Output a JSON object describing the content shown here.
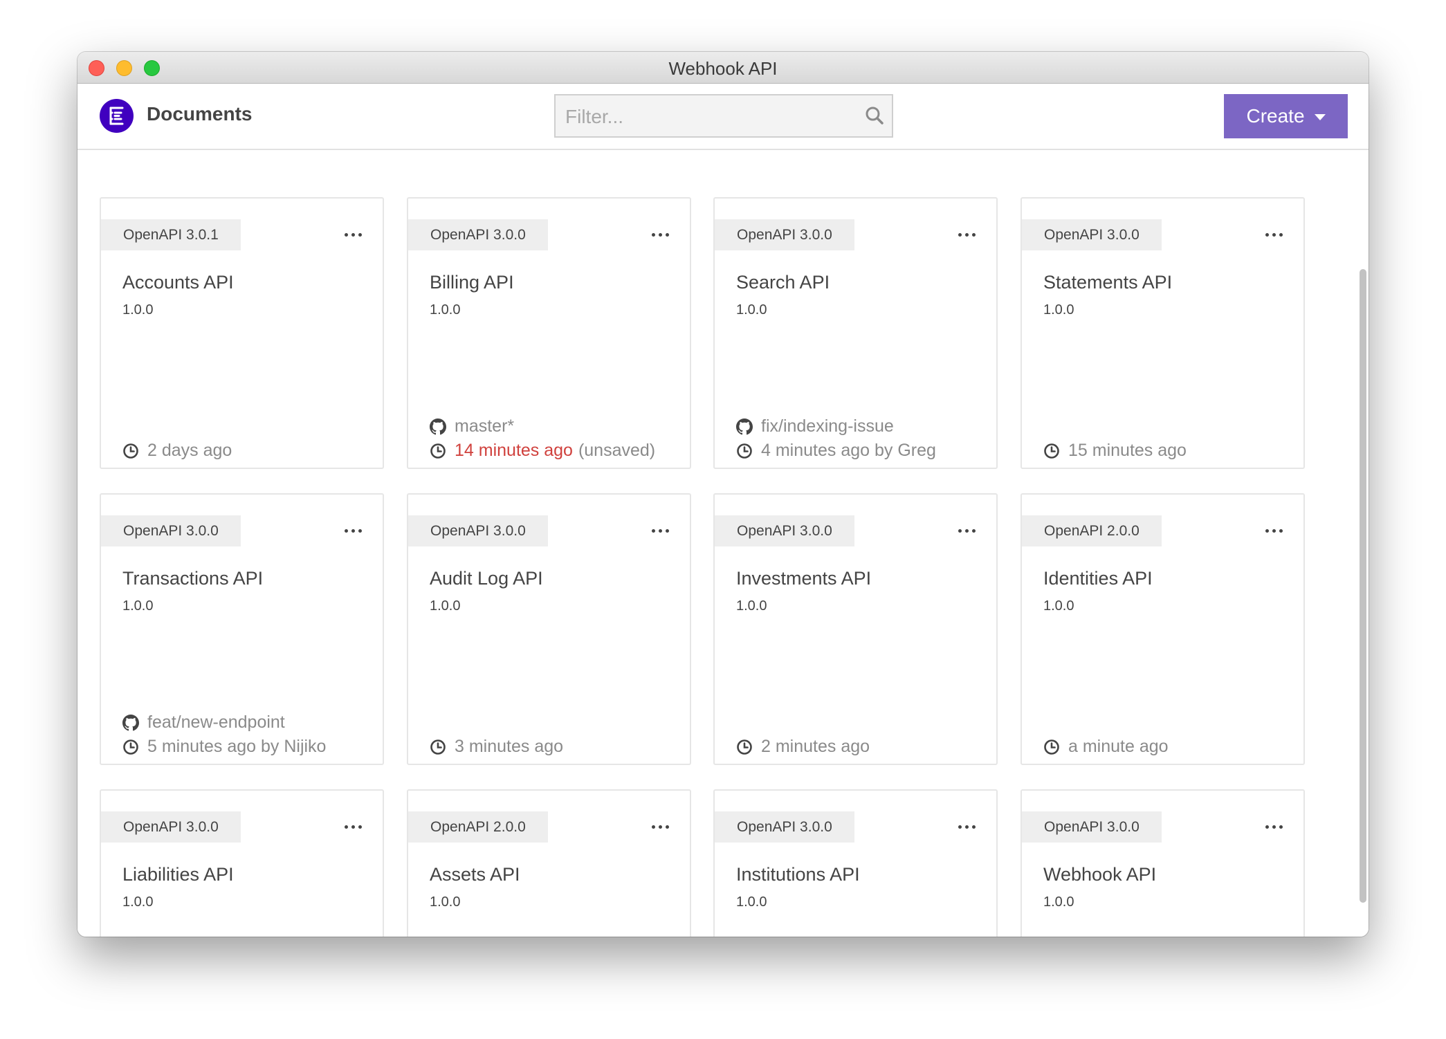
{
  "window": {
    "title": "Webhook API"
  },
  "header": {
    "brand": "Documents",
    "filter_placeholder": "Filter...",
    "create_label": "Create"
  },
  "colors": {
    "accent": "#7c66c4",
    "logo": "#4000bf",
    "warning": "#d0413d"
  },
  "cards": [
    {
      "spec": "OpenAPI 3.0.1",
      "title": "Accounts API",
      "version": "1.0.0",
      "branch": "",
      "time": "2 days ago",
      "time_suffix": "",
      "time_urgent": false
    },
    {
      "spec": "OpenAPI 3.0.0",
      "title": "Billing API",
      "version": "1.0.0",
      "branch": "master*",
      "time": "14 minutes ago",
      "time_suffix": "(unsaved)",
      "time_urgent": true
    },
    {
      "spec": "OpenAPI 3.0.0",
      "title": "Search API",
      "version": "1.0.0",
      "branch": "fix/indexing-issue",
      "time": "4 minutes ago by Greg",
      "time_suffix": "",
      "time_urgent": false
    },
    {
      "spec": "OpenAPI 3.0.0",
      "title": "Statements API",
      "version": "1.0.0",
      "branch": "",
      "time": "15 minutes ago",
      "time_suffix": "",
      "time_urgent": false
    },
    {
      "spec": "OpenAPI 3.0.0",
      "title": "Transactions API",
      "version": "1.0.0",
      "branch": "feat/new-endpoint",
      "time": "5 minutes ago by Nijiko",
      "time_suffix": "",
      "time_urgent": false
    },
    {
      "spec": "OpenAPI 3.0.0",
      "title": "Audit Log API",
      "version": "1.0.0",
      "branch": "",
      "time": "3 minutes ago",
      "time_suffix": "",
      "time_urgent": false
    },
    {
      "spec": "OpenAPI 3.0.0",
      "title": "Investments API",
      "version": "1.0.0",
      "branch": "",
      "time": "2 minutes ago",
      "time_suffix": "",
      "time_urgent": false
    },
    {
      "spec": "OpenAPI 2.0.0",
      "title": "Identities API",
      "version": "1.0.0",
      "branch": "",
      "time": "a minute ago",
      "time_suffix": "",
      "time_urgent": false
    },
    {
      "spec": "OpenAPI 3.0.0",
      "title": "Liabilities API",
      "version": "1.0.0",
      "branch": "",
      "time": "",
      "time_suffix": "",
      "time_urgent": false
    },
    {
      "spec": "OpenAPI 2.0.0",
      "title": "Assets API",
      "version": "1.0.0",
      "branch": "",
      "time": "",
      "time_suffix": "",
      "time_urgent": false
    },
    {
      "spec": "OpenAPI 3.0.0",
      "title": "Institutions API",
      "version": "1.0.0",
      "branch": "",
      "time": "",
      "time_suffix": "",
      "time_urgent": false
    },
    {
      "spec": "OpenAPI 3.0.0",
      "title": "Webhook API",
      "version": "1.0.0",
      "branch": "",
      "time": "",
      "time_suffix": "",
      "time_urgent": false
    }
  ]
}
